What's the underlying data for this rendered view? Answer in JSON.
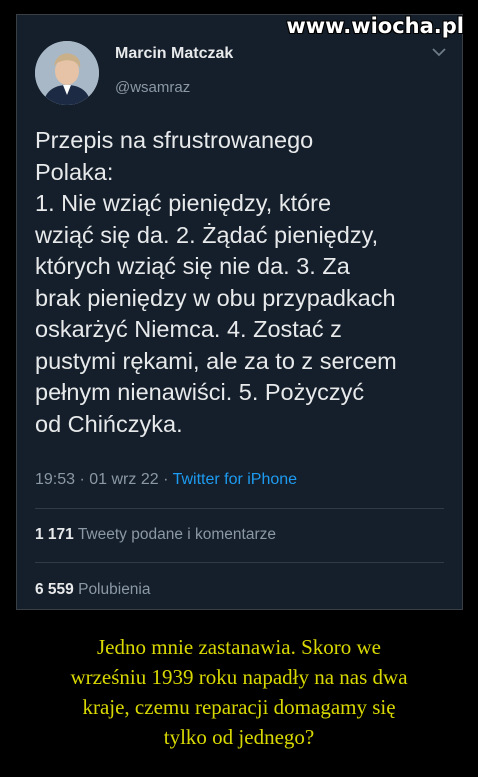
{
  "watermark": "www.wiocha.pl",
  "tweet": {
    "author": {
      "name": "Marcin Matczak",
      "handle": "@wsamraz"
    },
    "text": "Przepis na sfrustrowanego\nPolaka:\n1. Nie wziąć pieniędzy, które\nwziąć się da. 2. Żądać pieniędzy,\nktórych wziąć się nie da. 3. Za\nbrak pieniędzy w obu przypadkach\noskarżyć Niemca. 4. Zostać z\npustymi rękami, ale za to z sercem\npełnym nienawiści. 5. Pożyczyć\nod Chińczyka.",
    "time": "19:53 · 01 wrz 22 · ",
    "source": "Twitter for iPhone",
    "retweets": {
      "count": "1 171",
      "label": " Tweety podane i komentarze"
    },
    "likes": {
      "count": "6 559",
      "label": " Polubienia"
    }
  },
  "caption": "Jedno mnie zastanawia. Skoro we\nwrześniu 1939 roku napadły na nas dwa\nkraje, czemu reparacji domagamy się\ntylko od jednego?",
  "colors": {
    "background": "#000000",
    "card": "#151f2b",
    "caption": "#d9d900",
    "link": "#1d9bf0"
  },
  "icons": {
    "menu": "chevron-down-icon"
  }
}
